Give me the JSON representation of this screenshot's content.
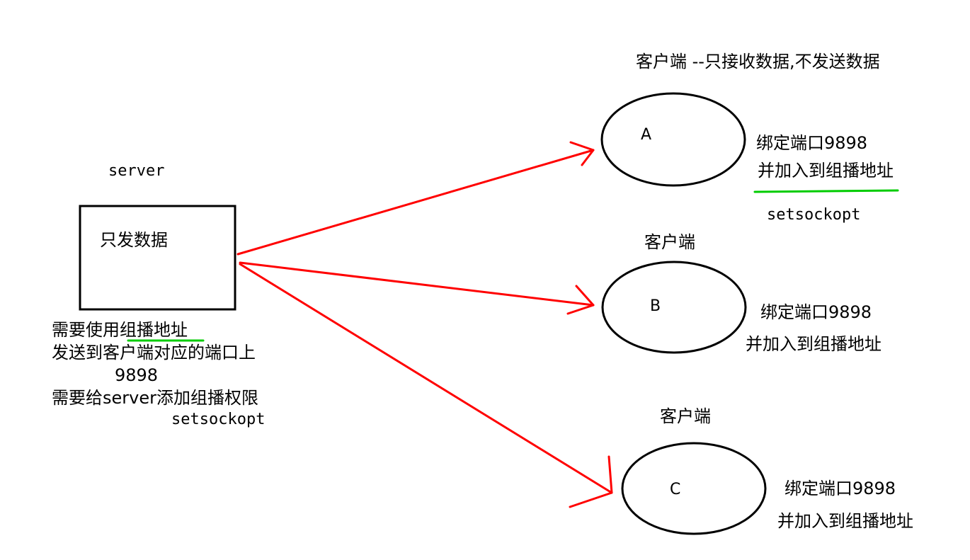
{
  "header": {
    "client_note": "客户端 --只接收数据,不发送数据"
  },
  "server": {
    "label": "server",
    "box_text": "只发数据",
    "note_prefix": "需要使用",
    "note_highlight": "组播地址",
    "note_line2": "发送到客户端对应的端口上",
    "note_port": "9898",
    "note_line4": "需要给server添加组播权限",
    "note_api": "setsockopt"
  },
  "clients": [
    {
      "title": "",
      "node": "A",
      "bind": "绑定端口9898",
      "join": "并加入到组播地址",
      "api": "setsockopt"
    },
    {
      "title": "客户端",
      "node": "B",
      "bind": "绑定端口9898",
      "join": "并加入到组播地址"
    },
    {
      "title": "客户端",
      "node": "C",
      "bind": "绑定端口9898",
      "join": "并加入到组播地址"
    }
  ],
  "colors": {
    "arrow": "#ff0000",
    "highlight": "#00cc00",
    "ink": "#000000"
  }
}
